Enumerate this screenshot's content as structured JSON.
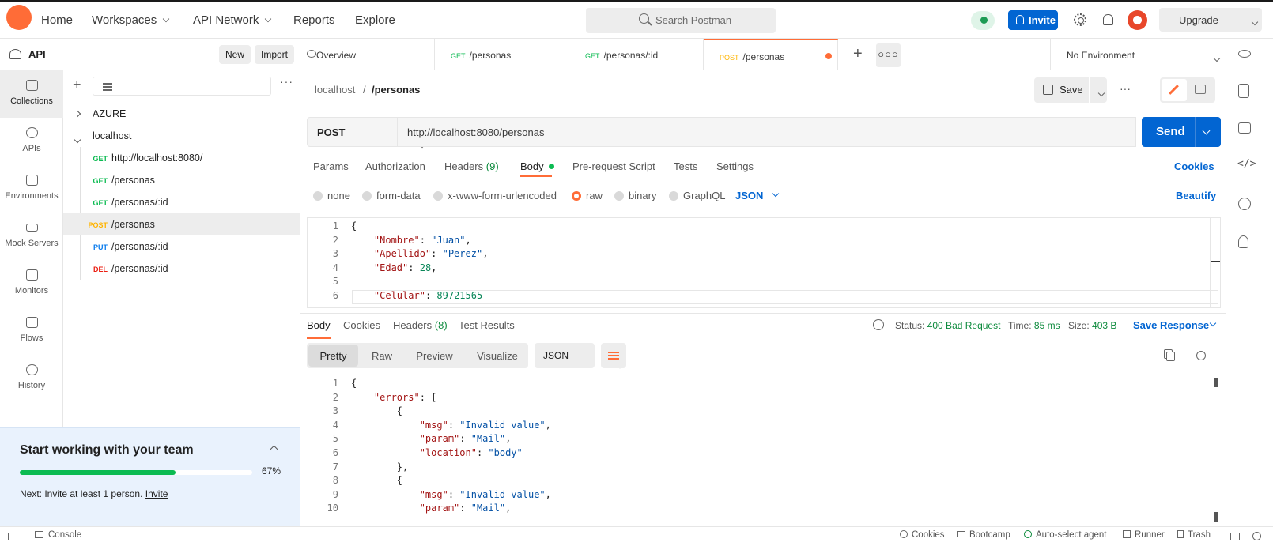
{
  "topbar": {
    "nav": [
      "Home",
      "Workspaces",
      "API Network",
      "Reports",
      "Explore"
    ],
    "search_placeholder": "Search Postman",
    "invite": "Invite",
    "upgrade": "Upgrade"
  },
  "sidebar": {
    "title": "API",
    "new": "New",
    "import": "Import",
    "rail": [
      "Collections",
      "APIs",
      "Environments",
      "Mock Servers",
      "Monitors",
      "Flows",
      "History"
    ],
    "collections": [
      {
        "name": "AZURE",
        "expanded": false
      },
      {
        "name": "localhost",
        "expanded": true
      }
    ],
    "requests": [
      {
        "method": "GET",
        "path": "http://localhost:8080/"
      },
      {
        "method": "GET",
        "path": "/personas"
      },
      {
        "method": "GET",
        "path": "/personas/:id"
      },
      {
        "method": "POST",
        "path": "/personas"
      },
      {
        "method": "PUT",
        "path": "/personas/:id"
      },
      {
        "method": "DEL",
        "path": "/personas/:id"
      }
    ]
  },
  "team_card": {
    "title": "Start working with your team",
    "progress_text": "67%",
    "progress_value": 0.67,
    "next_prefix": "Next: Invite at least 1 person.",
    "next_link": "Invite"
  },
  "tabs": [
    {
      "method": "",
      "label": "Overview"
    },
    {
      "method": "GET",
      "label": "/personas"
    },
    {
      "method": "GET",
      "label": "/personas/:id"
    },
    {
      "method": "POST",
      "label": "/personas"
    }
  ],
  "environment": "No Environment",
  "request": {
    "breadcrumb_parent": "localhost",
    "breadcrumb_sep": "/",
    "breadcrumb_current": "/personas",
    "save": "Save",
    "method": "POST",
    "url": "http://localhost:8080/personas",
    "send": "Send",
    "tabs": [
      "Params",
      "Authorization",
      "Headers",
      "Body",
      "Pre-request Script",
      "Tests",
      "Settings"
    ],
    "headers_count": "(9)",
    "cookies": "Cookies",
    "body_types": [
      "none",
      "form-data",
      "x-www-form-urlencoded",
      "raw",
      "binary",
      "GraphQL"
    ],
    "body_format": "JSON",
    "beautify": "Beautify",
    "body_lines": [
      {
        "n": "1",
        "text": "{"
      },
      {
        "n": "2",
        "text": "    \"Nombre\": \"Juan\","
      },
      {
        "n": "3",
        "text": "    \"Apellido\": \"Perez\","
      },
      {
        "n": "4",
        "text": "    \"Edad\": 28,"
      },
      {
        "n": "5",
        "text": ""
      },
      {
        "n": "6",
        "text": "    \"Celular\": 89721565"
      }
    ]
  },
  "response": {
    "tabs": [
      "Body",
      "Cookies",
      "Headers",
      "Test Results"
    ],
    "headers_count": "(8)",
    "status_label": "Status:",
    "status_value": "400 Bad Request",
    "time_label": "Time:",
    "time_value": "85 ms",
    "size_label": "Size:",
    "size_value": "403 B",
    "save_response": "Save Response",
    "views": [
      "Pretty",
      "Raw",
      "Preview",
      "Visualize"
    ],
    "format": "JSON",
    "body_lines": [
      {
        "n": "1",
        "text": "{"
      },
      {
        "n": "2",
        "text": "    \"errors\": ["
      },
      {
        "n": "3",
        "text": "        {"
      },
      {
        "n": "4",
        "text": "            \"msg\": \"Invalid value\","
      },
      {
        "n": "5",
        "text": "            \"param\": \"Mail\","
      },
      {
        "n": "6",
        "text": "            \"location\": \"body\""
      },
      {
        "n": "7",
        "text": "        },"
      },
      {
        "n": "8",
        "text": "        {"
      },
      {
        "n": "9",
        "text": "            \"msg\": \"Invalid value\","
      },
      {
        "n": "10",
        "text": "            \"param\": \"Mail\","
      }
    ]
  },
  "footer": {
    "console": "Console",
    "cookies": "Cookies",
    "bootcamp": "Bootcamp",
    "auto_select": "Auto-select agent",
    "runner": "Runner",
    "trash": "Trash"
  },
  "colors": {
    "accent": "#ff6c37",
    "primary": "#0265d2",
    "success": "#0cbb52"
  }
}
